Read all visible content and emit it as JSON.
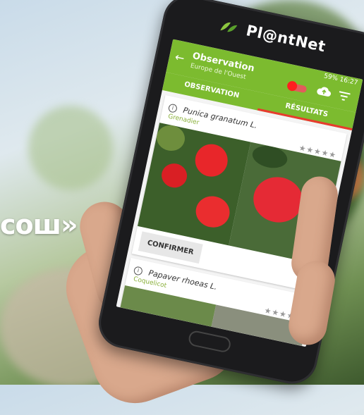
{
  "overlay_text": "сош»",
  "phone": {
    "brand": "Pl@ntNet"
  },
  "status_bar": {
    "battery": "59%",
    "time": "16:27"
  },
  "app_bar": {
    "title": "Observation",
    "subtitle": "Europe de l'Ouest"
  },
  "tabs": [
    {
      "label": "OBSERVATION"
    },
    {
      "label": "RÉSULTATS"
    }
  ],
  "results": [
    {
      "species": "Punica granatum L.",
      "common_name": "Grenadier",
      "stars": "★★★★★",
      "confirm_label": "CONFIRMER"
    },
    {
      "species": "Papaver rhoeas L.",
      "common_name": "Coquelicot",
      "stars": "★★★★★"
    }
  ],
  "colors": {
    "brand_green": "#7cbb2f",
    "accent_red": "#e83b2e"
  },
  "icons": [
    "back-arrow-icon",
    "cloud-upload-icon",
    "filter-icon",
    "info-icon",
    "logo-leaf-icon"
  ]
}
